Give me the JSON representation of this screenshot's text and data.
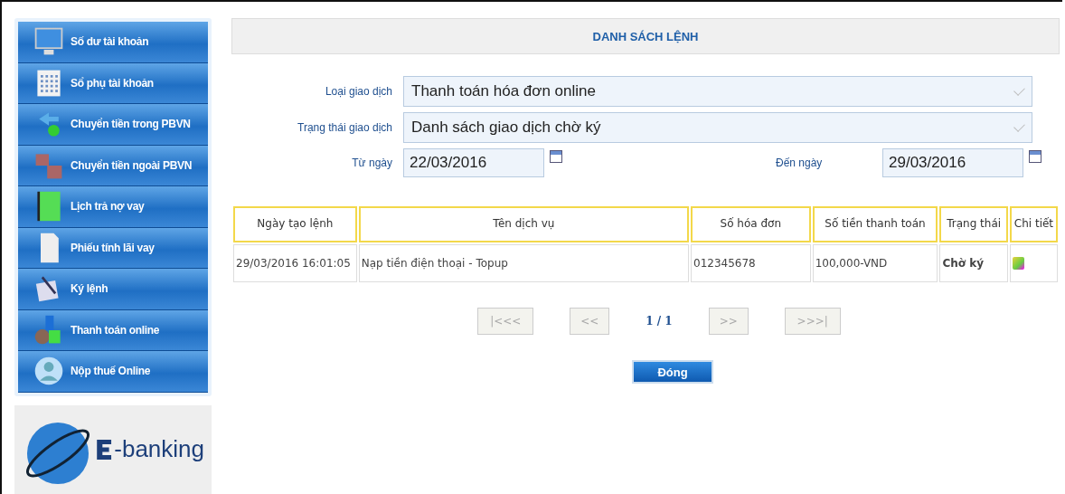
{
  "sidebar": {
    "items": [
      {
        "label": "Số dư tài khoản"
      },
      {
        "label": "Sổ phụ tài khoản"
      },
      {
        "label": "Chuyển tiền trong PBVN"
      },
      {
        "label": "Chuyển tiền ngoài PBVN"
      },
      {
        "label": "Lịch trả nợ vay"
      },
      {
        "label": "Phiếu tính lãi vay"
      },
      {
        "label": "Ký lệnh"
      },
      {
        "label": "Thanh toán online"
      },
      {
        "label": "Nộp thuế Online"
      }
    ],
    "logo": {
      "text": "-banking"
    }
  },
  "title": "DANH SÁCH LỆNH",
  "form": {
    "transaction_type": {
      "label": "Loại giao dịch",
      "value": "Thanh toán hóa đơn online"
    },
    "transaction_status": {
      "label": "Trạng thái giao dịch",
      "value": "Danh sách giao dịch chờ ký"
    },
    "from_date": {
      "label": "Từ ngày",
      "value": "22/03/2016"
    },
    "to_date": {
      "label": "Đến ngày",
      "value": "29/03/2016"
    }
  },
  "table": {
    "columns": [
      "Ngày tạo lệnh",
      "Tên dịch vụ",
      "Số hóa đơn",
      "Số tiền thanh toán",
      "Trạng thái",
      "Chi tiết"
    ],
    "rows": [
      {
        "cells": [
          "29/03/2016 16:01:05",
          "Nạp tiền điện thoại - Topup",
          "012345678",
          "100,000-VND",
          "Chờ ký"
        ]
      }
    ]
  },
  "pager": {
    "first": {
      "label": "|<<<",
      "disabled": true
    },
    "prev": {
      "label": "<<",
      "disabled": true
    },
    "page": "1 / 1",
    "next": {
      "label": ">>",
      "disabled": true
    },
    "last": {
      "label": ">>>|",
      "disabled": true
    }
  },
  "close_button": "Đóng"
}
